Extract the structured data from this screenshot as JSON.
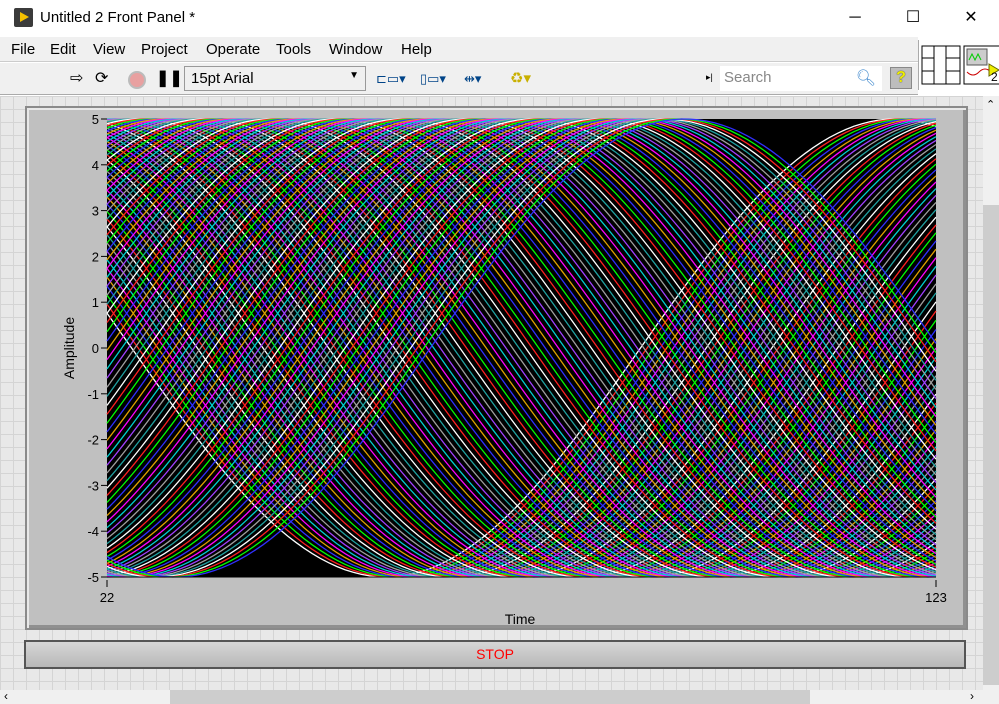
{
  "window": {
    "title": "Untitled 2 Front Panel *",
    "minimize": "─",
    "maximize": "☐",
    "close": "✕"
  },
  "menu": [
    "File",
    "Edit",
    "View",
    "Project",
    "Operate",
    "Tools",
    "Window",
    "Help"
  ],
  "toolbar": {
    "font": "15pt Arial",
    "search_placeholder": "Search",
    "help": "?",
    "connector_count": "2"
  },
  "stop_button": {
    "label": "STOP"
  },
  "colors": {
    "plot_bg": "#000000",
    "stop_text": "#ff0000",
    "frame": "#c0c0c0"
  },
  "chart_data": {
    "type": "line",
    "xlabel": "Time",
    "ylabel": "Amplitude",
    "xlim": [
      22,
      123
    ],
    "ylim": [
      -5,
      5
    ],
    "x_ticks": [
      "22",
      "123"
    ],
    "y_ticks": [
      "5",
      "4",
      "3",
      "2",
      "1",
      "0",
      "-1",
      "-2",
      "-3",
      "-4",
      "-5"
    ],
    "grid": false,
    "series_model": {
      "shape": "sine",
      "amplitude": 5,
      "period": 124,
      "phase_min": -37,
      "phase_max": 62,
      "phase_step": 0.8
    },
    "series_colors": [
      "#ffffff",
      "#ff2020",
      "#00ff00",
      "#3030ff",
      "#e0a000",
      "#ff00ff",
      "#00d0d0",
      "#a040ff",
      "#a0a0a0",
      "#20a0a0"
    ]
  }
}
